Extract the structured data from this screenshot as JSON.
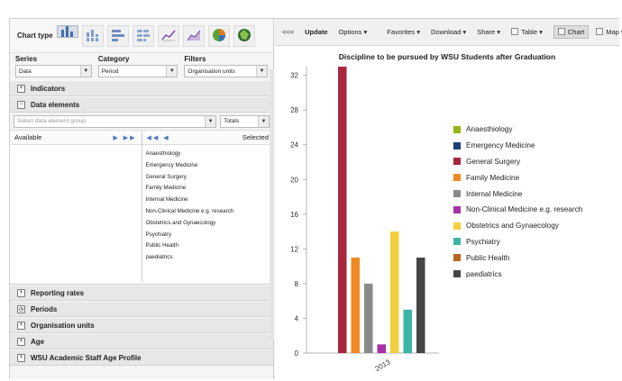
{
  "left": {
    "chart_type_label": "Chart type",
    "chart_types": [
      {
        "icon": "column-chart-icon",
        "selected": true
      },
      {
        "icon": "stacked-column-chart-icon",
        "selected": false
      },
      {
        "icon": "bar-chart-icon",
        "selected": false
      },
      {
        "icon": "stacked-bar-chart-icon",
        "selected": false
      },
      {
        "icon": "line-chart-icon",
        "selected": false
      },
      {
        "icon": "area-chart-icon",
        "selected": false
      },
      {
        "icon": "pie-chart-icon",
        "selected": false
      },
      {
        "icon": "radar-chart-icon",
        "selected": false
      }
    ],
    "series": {
      "label": "Series",
      "value": "Data"
    },
    "category": {
      "label": "Category",
      "value": "Period"
    },
    "filters": {
      "label": "Filters",
      "value": "Organisation units"
    },
    "sections_top": [
      {
        "label": "Indicators",
        "icon": "plus-icon"
      },
      {
        "label": "Data elements",
        "icon": "minus-icon"
      }
    ],
    "data_elements": {
      "group_placeholder": "Select data element group",
      "totals_value": "Totals",
      "available_label": "Available",
      "selected_label": "Selected",
      "selected_items": [
        "Anaesthiology",
        "Emergency Medicine",
        "General Surgery",
        "Family Medicine",
        "Internal Medicine",
        "Non-Clinical Medicine e.g. research",
        "Obstetrics and Gynaecology",
        "Psychiatry",
        "Public Health",
        "paediatrics"
      ]
    },
    "sections_bottom": [
      {
        "label": "Reporting rates",
        "icon": "plus-icon"
      },
      {
        "label": "Periods",
        "icon": "clock-icon"
      },
      {
        "label": "Organisation units",
        "icon": "plus-icon"
      },
      {
        "label": "Age",
        "icon": "plus-icon"
      },
      {
        "label": "WSU Academic Staff Age Profile",
        "icon": "plus-icon"
      }
    ]
  },
  "toolbar": {
    "collapse": "<<<",
    "update": "Update",
    "options": "Options",
    "favorites": "Favorites",
    "download": "Download",
    "share": "Share",
    "table": "Table",
    "chart": "Chart",
    "map": "Map"
  },
  "colors": {
    "accent_blue": "#4a78c0"
  },
  "chart_data": {
    "type": "bar",
    "title": "Discipline to be pursued by WSU Students after Graduation",
    "categories": [
      "2013"
    ],
    "ylim": [
      0,
      33
    ],
    "yticks": [
      0,
      4,
      8,
      12,
      16,
      20,
      24,
      28,
      32
    ],
    "grid": false,
    "legend_position": "right",
    "series": [
      {
        "name": "Anaesthiology",
        "values": [
          0
        ],
        "color": "#94b514"
      },
      {
        "name": "Emergency Medicine",
        "values": [
          0
        ],
        "color": "#1a3f7a"
      },
      {
        "name": "General Surgery",
        "values": [
          33
        ],
        "color": "#a8273e"
      },
      {
        "name": "Family Medicine",
        "values": [
          11
        ],
        "color": "#f08a24"
      },
      {
        "name": "Internal Medicine",
        "values": [
          8
        ],
        "color": "#8a8a8a"
      },
      {
        "name": "Non-Clinical Medicine e.g. research",
        "values": [
          1
        ],
        "color": "#a632a6"
      },
      {
        "name": "Obstetrics and Gynaecology",
        "values": [
          14
        ],
        "color": "#f2cf3c"
      },
      {
        "name": "Psychiatry",
        "values": [
          5
        ],
        "color": "#3bb5a3"
      },
      {
        "name": "Public Health",
        "values": [
          0
        ],
        "color": "#b8661e"
      },
      {
        "name": "paediatrics",
        "values": [
          11
        ],
        "color": "#454545"
      }
    ]
  }
}
